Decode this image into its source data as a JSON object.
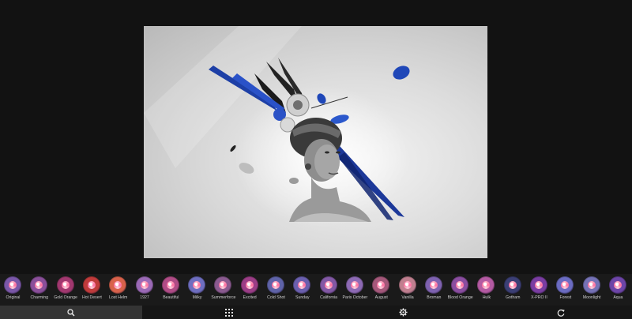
{
  "photo": {
    "description_icon": "image-preview"
  },
  "filters": [
    {
      "label": "Original",
      "color": "#7a57a8"
    },
    {
      "label": "Charming",
      "color": "#8a4f9a"
    },
    {
      "label": "Gold Orange",
      "color": "#a2386f"
    },
    {
      "label": "Hot Desert",
      "color": "#c03b3b"
    },
    {
      "label": "Lost Helm",
      "color": "#d8624b"
    },
    {
      "label": "1927",
      "color": "#9b6ab6"
    },
    {
      "label": "Beautiful",
      "color": "#b04c86"
    },
    {
      "label": "Milky",
      "color": "#6e6ec0"
    },
    {
      "label": "Summerforce",
      "color": "#8a5a8f"
    },
    {
      "label": "Excited",
      "color": "#9b3d86"
    },
    {
      "label": "Cold Shot",
      "color": "#5f63a8"
    },
    {
      "label": "Sunday",
      "color": "#6a5fae"
    },
    {
      "label": "California",
      "color": "#8258a5"
    },
    {
      "label": "Paris October",
      "color": "#8d6ab4"
    },
    {
      "label": "August",
      "color": "#a4587a"
    },
    {
      "label": "Vanilla",
      "color": "#c07f8f"
    },
    {
      "label": "Broman",
      "color": "#7e62b0"
    },
    {
      "label": "Blood Orange",
      "color": "#8a4da0"
    },
    {
      "label": "Hulk",
      "color": "#b45aa2"
    },
    {
      "label": "Gotham",
      "color": "#3b3f75"
    },
    {
      "label": "X-PRO II",
      "color": "#7a3da2"
    },
    {
      "label": "Forest",
      "color": "#6b6cc2"
    },
    {
      "label": "Moonlight",
      "color": "#7572b6"
    },
    {
      "label": "Aqua",
      "color": "#6d45a8"
    }
  ],
  "toolbar": {
    "zoom_icon": "magnifier-icon",
    "grid_icon": "grid-icon",
    "settings_icon": "gear-icon",
    "rotate_icon": "rotate-icon"
  },
  "colors": {
    "background": "#121212",
    "strip": "#1a1a1a",
    "toolbar": "#161616",
    "active_tool": "#343434",
    "accent_blue": "#1d3fa6"
  }
}
